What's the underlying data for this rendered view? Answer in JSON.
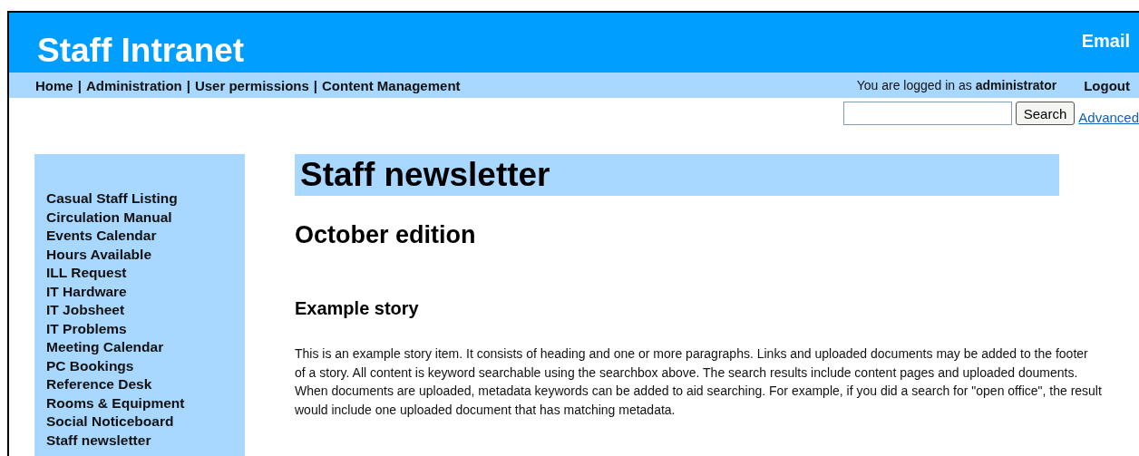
{
  "header": {
    "title": "Staff Intranet",
    "email_link": "Email"
  },
  "nav": {
    "separator": "|",
    "items": [
      "Home",
      "Administration",
      "User permissions",
      "Content Management"
    ],
    "logged_in": "You are logged in as **administrator**",
    "logout": "Logout"
  },
  "search": {
    "button": "Search",
    "advanced_link": "Advanced"
  },
  "sidebar": {
    "items": [
      "Casual Staff Listing",
      "Circulation Manual",
      "Events Calendar",
      "Hours Available",
      "ILL Request",
      "IT Hardware",
      "IT Jobsheet",
      "IT Problems",
      "Meeting Calendar",
      "PC Bookings",
      "Reference Desk",
      "Rooms & Equipment",
      "Social Noticeboard",
      "Staff newsletter"
    ]
  },
  "main": {
    "title": "Staff newsletter",
    "edition": "October edition",
    "story_heading": "Example story",
    "story_text": "This is an example story item. It consists of heading and one or more paragraphs. Links and uploaded documents may be added to the footer of a story. All content is keyword searchable using the searchbox above. The search results include content pages and uploaded douments. When documents are uploaded, metadata keywords can be added to aid searching. For example, if you did a search for \"open office\", the result would include one uploaded document that has matching metadata."
  }
}
